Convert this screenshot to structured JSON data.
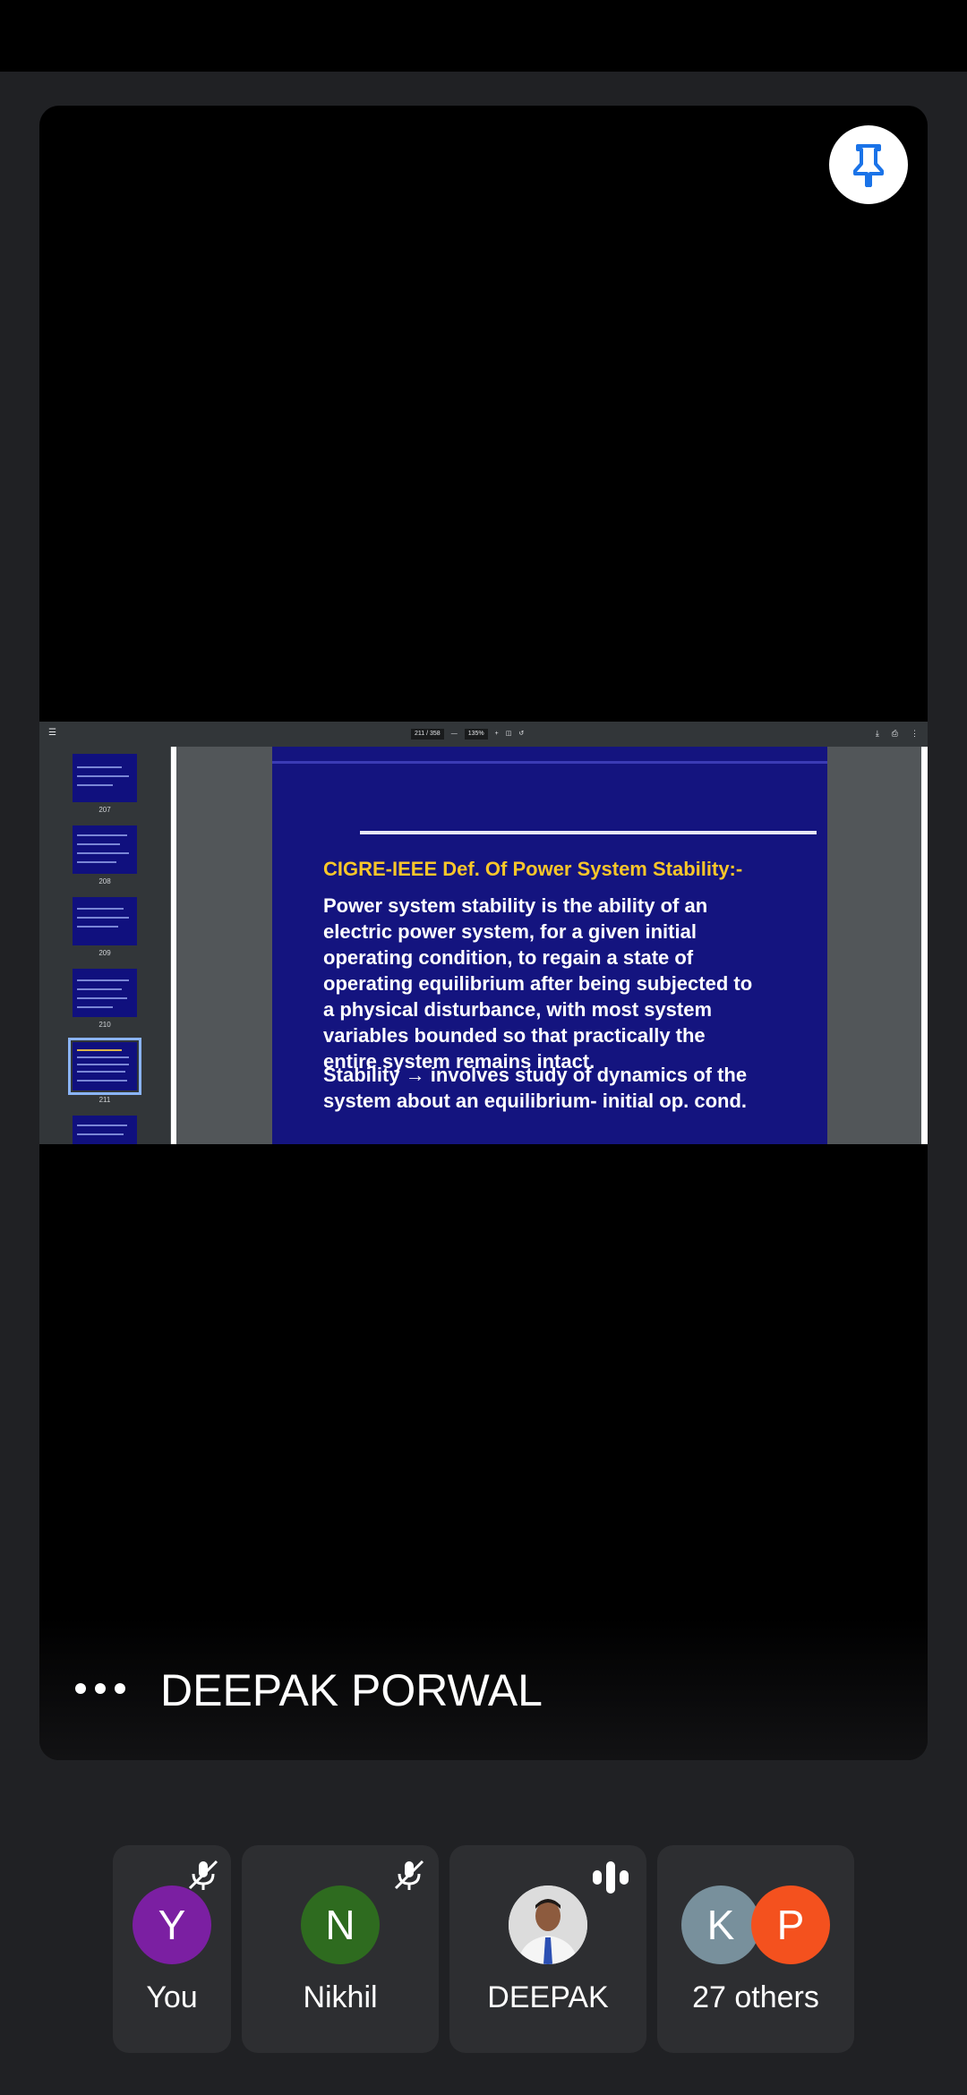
{
  "meeting": {
    "active_speaker": "DEEPAK PORWAL"
  },
  "pdf_viewer": {
    "page_indicator": "211 / 358",
    "zoom": "135%",
    "thumbnails": [
      {
        "number": "207"
      },
      {
        "number": "208"
      },
      {
        "number": "209"
      },
      {
        "number": "210"
      },
      {
        "number": "211",
        "selected": true
      }
    ]
  },
  "slide": {
    "title": "CIGRE-IEEE Def. Of Power System Stability:-",
    "definition_lines": [
      "Power system stability is the ability of an",
      "electric power system, for a given initial",
      "operating condition, to regain a state of",
      "operating equilibrium after being subjected to",
      "a physical disturbance, with most system",
      "variables bounded so that practically the",
      "entire system remains intact."
    ],
    "stability_lines": [
      "Stability → involves study of dynamics of the",
      "system about an equilibrium- initial op. cond."
    ]
  },
  "participants": [
    {
      "initial": "Y",
      "name": "You",
      "color": "#7b1fa2",
      "muted": true
    },
    {
      "initial": "N",
      "name": "Nikhil",
      "color": "#2e6b1f",
      "muted": true
    },
    {
      "name": "DEEPAK",
      "speaking": true
    },
    {
      "initials": [
        "K",
        "P"
      ],
      "colors": [
        "#78909c",
        "#f4511e"
      ],
      "name": "27 others"
    }
  ],
  "icons": {
    "pin": "pin-icon",
    "more": "more-options-icon",
    "mic_off": "mic-off-icon",
    "speaking": "audio-level-icon"
  }
}
